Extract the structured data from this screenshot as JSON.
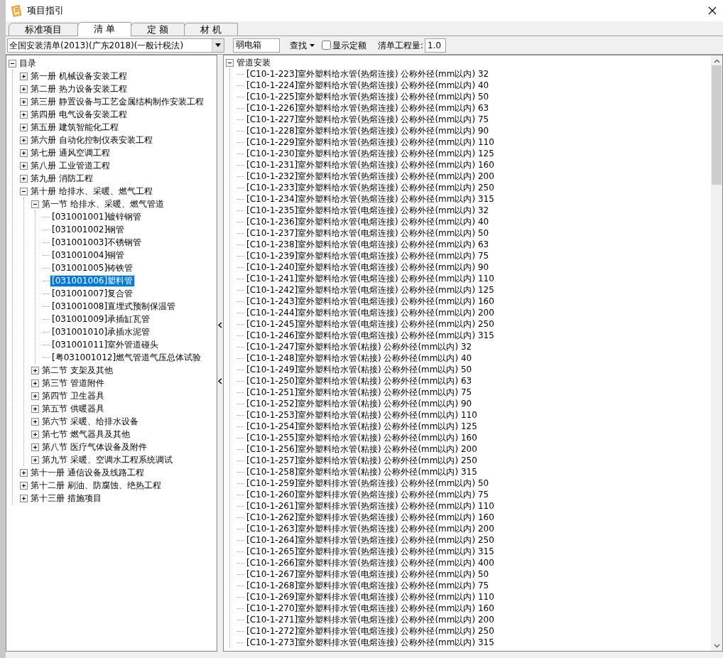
{
  "window": {
    "title": "项目指引"
  },
  "tabs": [
    {
      "label": "标准项目",
      "selected": false
    },
    {
      "label": "清 单",
      "selected": true
    },
    {
      "label": "定 额",
      "selected": false
    },
    {
      "label": "材 机",
      "selected": false
    }
  ],
  "toolbar": {
    "library": "全国安装清单(2013)(广东2018)(一般计税法)",
    "search_value": "弱电箱",
    "find_button": "查找",
    "show_quota": {
      "label": "显示定额",
      "checked": false
    },
    "quantity_label": "清单工程量:",
    "quantity_value": "1.0"
  },
  "catalog_tree": {
    "label": "目录",
    "expanded": true,
    "selected": false,
    "children": [
      {
        "label": "第一册  机械设备安装工程",
        "expanded": false,
        "selected": false
      },
      {
        "label": "第二册  热力设备安装工程",
        "expanded": false,
        "selected": false
      },
      {
        "label": "第三册  静置设备与工艺金属结构制作安装工程",
        "expanded": false,
        "selected": false
      },
      {
        "label": "第四册  电气设备安装工程",
        "expanded": false,
        "selected": false
      },
      {
        "label": "第五册  建筑智能化工程",
        "expanded": false,
        "selected": false
      },
      {
        "label": "第六册  自动化控制仪表安装工程",
        "expanded": false,
        "selected": false
      },
      {
        "label": "第七册  通风空调工程",
        "expanded": false,
        "selected": false
      },
      {
        "label": "第八册  工业管道工程",
        "expanded": false,
        "selected": false
      },
      {
        "label": "第九册  消防工程",
        "expanded": false,
        "selected": false
      },
      {
        "label": "第十册  给排水、采暖、燃气工程",
        "expanded": true,
        "selected": false,
        "children": [
          {
            "label": "第一节 给排水、采暖、燃气管道",
            "expanded": true,
            "selected": false,
            "children": [
              {
                "label": "[031001001]镀锌钢管",
                "selected": false
              },
              {
                "label": "[031001002]钢管",
                "selected": false
              },
              {
                "label": "[031001003]不锈钢管",
                "selected": false
              },
              {
                "label": "[031001004]铜管",
                "selected": false
              },
              {
                "label": "[031001005]铸铁管",
                "selected": false
              },
              {
                "label": "[031001006]塑料管",
                "selected": true
              },
              {
                "label": "[031001007]复合管",
                "selected": false
              },
              {
                "label": "[031001008]直埋式预制保温管",
                "selected": false
              },
              {
                "label": "[031001009]承插缸瓦管",
                "selected": false
              },
              {
                "label": "[031001010]承插水泥管",
                "selected": false
              },
              {
                "label": "[031001011]室外管道碰头",
                "selected": false
              },
              {
                "label": "[粤031001012]燃气管道气压总体试验",
                "selected": false
              }
            ]
          },
          {
            "label": "第二节  支架及其他",
            "expanded": false,
            "selected": false
          },
          {
            "label": "第三节  管道附件",
            "expanded": false,
            "selected": false
          },
          {
            "label": "第四节  卫生器具",
            "expanded": false,
            "selected": false
          },
          {
            "label": "第五节  供暖器具",
            "expanded": false,
            "selected": false
          },
          {
            "label": "第六节  采暖、给排水设备",
            "expanded": false,
            "selected": false
          },
          {
            "label": "第七节 燃气器具及其他",
            "expanded": false,
            "selected": false
          },
          {
            "label": "第八节  医疗气体设备及附件",
            "expanded": false,
            "selected": false
          },
          {
            "label": "第九节 采暖、空调水工程系统调试",
            "expanded": false,
            "selected": false
          }
        ]
      },
      {
        "label": "第十一册  通信设备及线路工程",
        "expanded": false,
        "selected": false
      },
      {
        "label": "第十二册  刷油、防腐蚀、绝热工程",
        "expanded": false,
        "selected": false
      },
      {
        "label": "第十三册  措施项目",
        "expanded": false,
        "selected": false
      }
    ]
  },
  "quota_tree": {
    "label": "管道安装",
    "expanded": true,
    "selected": false,
    "children": [
      {
        "label": "[C10-1-223]室外塑料给水管(热熔连接) 公称外径(mm以内) 32",
        "selected": false
      },
      {
        "label": "[C10-1-224]室外塑料给水管(热熔连接) 公称外径(mm以内) 40",
        "selected": false
      },
      {
        "label": "[C10-1-225]室外塑料给水管(热熔连接) 公称外径(mm以内) 50",
        "selected": false
      },
      {
        "label": "[C10-1-226]室外塑料给水管(热熔连接) 公称外径(mm以内) 63",
        "selected": false
      },
      {
        "label": "[C10-1-227]室外塑料给水管(热熔连接) 公称外径(mm以内) 75",
        "selected": false
      },
      {
        "label": "[C10-1-228]室外塑料给水管(热熔连接) 公称外径(mm以内) 90",
        "selected": false
      },
      {
        "label": "[C10-1-229]室外塑料给水管(热熔连接) 公称外径(mm以内) 110",
        "selected": false
      },
      {
        "label": "[C10-1-230]室外塑料给水管(热熔连接) 公称外径(mm以内) 125",
        "selected": false
      },
      {
        "label": "[C10-1-231]室外塑料给水管(热熔连接) 公称外径(mm以内) 160",
        "selected": false
      },
      {
        "label": "[C10-1-232]室外塑料给水管(热熔连接) 公称外径(mm以内) 200",
        "selected": false
      },
      {
        "label": "[C10-1-233]室外塑料给水管(热熔连接) 公称外径(mm以内) 250",
        "selected": false
      },
      {
        "label": "[C10-1-234]室外塑料给水管(热熔连接) 公称外径(mm以内) 315",
        "selected": false
      },
      {
        "label": "[C10-1-235]室外塑料给水管(电熔连接) 公称外径(mm以内) 32",
        "selected": false
      },
      {
        "label": "[C10-1-236]室外塑料给水管(电熔连接) 公称外径(mm以内) 40",
        "selected": false
      },
      {
        "label": "[C10-1-237]室外塑料给水管(电熔连接) 公称外径(mm以内) 50",
        "selected": false
      },
      {
        "label": "[C10-1-238]室外塑料给水管(电熔连接) 公称外径(mm以内) 63",
        "selected": false
      },
      {
        "label": "[C10-1-239]室外塑料给水管(电熔连接) 公称外径(mm以内) 75",
        "selected": false
      },
      {
        "label": "[C10-1-240]室外塑料给水管(电熔连接) 公称外径(mm以内) 90",
        "selected": false
      },
      {
        "label": "[C10-1-241]室外塑料给水管(电熔连接) 公称外径(mm以内) 110",
        "selected": false
      },
      {
        "label": "[C10-1-242]室外塑料给水管(电熔连接) 公称外径(mm以内) 125",
        "selected": false
      },
      {
        "label": "[C10-1-243]室外塑料给水管(电熔连接) 公称外径(mm以内) 160",
        "selected": false
      },
      {
        "label": "[C10-1-244]室外塑料给水管(电熔连接) 公称外径(mm以内) 200",
        "selected": false
      },
      {
        "label": "[C10-1-245]室外塑料给水管(电熔连接) 公称外径(mm以内) 250",
        "selected": false
      },
      {
        "label": "[C10-1-246]室外塑料给水管(电熔连接) 公称外径(mm以内) 315",
        "selected": false
      },
      {
        "label": "[C10-1-247]室外塑料给水管(粘接) 公称外径(mm以内) 32",
        "selected": false
      },
      {
        "label": "[C10-1-248]室外塑料给水管(粘接) 公称外径(mm以内) 40",
        "selected": false
      },
      {
        "label": "[C10-1-249]室外塑料给水管(粘接) 公称外径(mm以内) 50",
        "selected": false
      },
      {
        "label": "[C10-1-250]室外塑料给水管(粘接) 公称外径(mm以内) 63",
        "selected": false
      },
      {
        "label": "[C10-1-251]室外塑料给水管(粘接) 公称外径(mm以内) 75",
        "selected": false
      },
      {
        "label": "[C10-1-252]室外塑料给水管(粘接) 公称外径(mm以内) 90",
        "selected": false
      },
      {
        "label": "[C10-1-253]室外塑料给水管(粘接) 公称外径(mm以内) 110",
        "selected": false
      },
      {
        "label": "[C10-1-254]室外塑料给水管(粘接) 公称外径(mm以内) 125",
        "selected": false
      },
      {
        "label": "[C10-1-255]室外塑料给水管(粘接) 公称外径(mm以内) 160",
        "selected": false
      },
      {
        "label": "[C10-1-256]室外塑料给水管(粘接) 公称外径(mm以内) 200",
        "selected": false
      },
      {
        "label": "[C10-1-257]室外塑料给水管(粘接) 公称外径(mm以内) 250",
        "selected": false
      },
      {
        "label": "[C10-1-258]室外塑料给水管(粘接) 公称外径(mm以内) 315",
        "selected": false
      },
      {
        "label": "[C10-1-259]室外塑料排水管(热熔连接) 公称外径(mm以内) 50",
        "selected": false
      },
      {
        "label": "[C10-1-260]室外塑料排水管(热熔连接) 公称外径(mm以内) 75",
        "selected": false
      },
      {
        "label": "[C10-1-261]室外塑料排水管(热熔连接) 公称外径(mm以内) 110",
        "selected": false
      },
      {
        "label": "[C10-1-262]室外塑料排水管(热熔连接) 公称外径(mm以内) 160",
        "selected": false
      },
      {
        "label": "[C10-1-263]室外塑料排水管(热熔连接) 公称外径(mm以内) 200",
        "selected": false
      },
      {
        "label": "[C10-1-264]室外塑料排水管(热熔连接) 公称外径(mm以内) 250",
        "selected": false
      },
      {
        "label": "[C10-1-265]室外塑料排水管(热熔连接) 公称外径(mm以内) 315",
        "selected": false
      },
      {
        "label": "[C10-1-266]室外塑料排水管(热熔连接) 公称外径(mm以内) 400",
        "selected": false
      },
      {
        "label": "[C10-1-267]室外塑料排水管(电熔连接) 公称外径(mm以内) 50",
        "selected": false
      },
      {
        "label": "[C10-1-268]室外塑料排水管(电熔连接) 公称外径(mm以内) 75",
        "selected": false
      },
      {
        "label": "[C10-1-269]室外塑料排水管(电熔连接) 公称外径(mm以内) 110",
        "selected": false
      },
      {
        "label": "[C10-1-270]室外塑料排水管(电熔连接) 公称外径(mm以内) 160",
        "selected": false
      },
      {
        "label": "[C10-1-271]室外塑料排水管(电熔连接) 公称外径(mm以内) 200",
        "selected": false
      },
      {
        "label": "[C10-1-272]室外塑料排水管(电熔连接) 公称外径(mm以内) 250",
        "selected": false
      },
      {
        "label": "[C10-1-273]室外塑料排水管(电熔连接) 公称外径(mm以内) 315",
        "selected": false
      }
    ]
  }
}
